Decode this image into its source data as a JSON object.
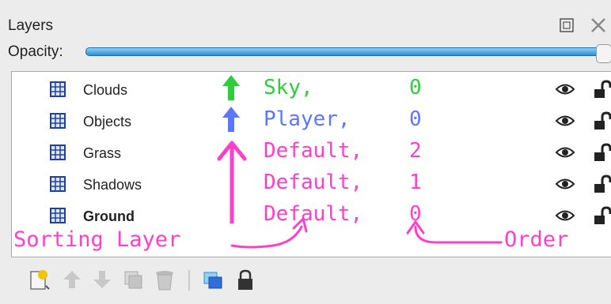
{
  "panel": {
    "title": "Layers",
    "opacity_label": "Opacity:",
    "opacity_value": 1.0
  },
  "colors": {
    "sky": "#2fcc3c",
    "player": "#5b76ff",
    "default": "#ff3ecb",
    "highlight": "#1d6ea8"
  },
  "layers": [
    {
      "name": "Clouds",
      "sorting_layer": "Sky,",
      "order": "0",
      "bold": false,
      "color": "#2fcc3c",
      "icon": "grid-icon"
    },
    {
      "name": "Objects",
      "sorting_layer": "Player,",
      "order": "0",
      "bold": false,
      "color": "#5b76ff",
      "icon": "grid-icon"
    },
    {
      "name": "Grass",
      "sorting_layer": "Default,",
      "order": "2",
      "bold": false,
      "color": "#ff3ecb",
      "icon": "grid-icon"
    },
    {
      "name": "Shadows",
      "sorting_layer": "Default,",
      "order": "1",
      "bold": false,
      "color": "#ff3ecb",
      "icon": "grid-icon"
    },
    {
      "name": "Ground",
      "sorting_layer": "Default,",
      "order": "0",
      "bold": true,
      "color": "#ff3ecb",
      "icon": "grid-icon"
    }
  ],
  "annotations": {
    "sorting_layer": "Sorting Layer",
    "order": "Order"
  },
  "toolbar": [
    "new-layer-icon",
    "move-up-icon",
    "move-down-icon",
    "duplicate-icon",
    "delete-icon",
    "layer-group-icon",
    "lock-icon"
  ]
}
